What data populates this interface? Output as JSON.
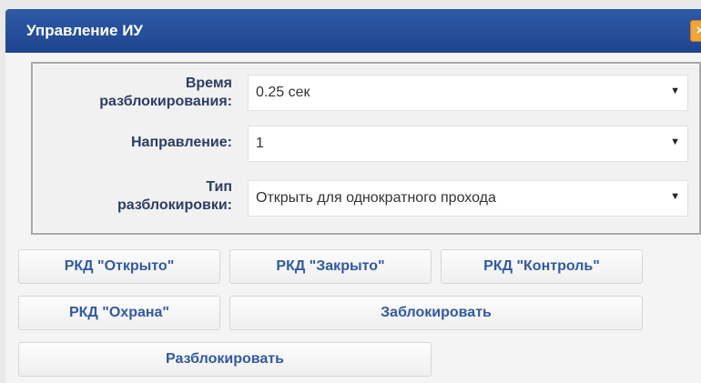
{
  "dialog": {
    "title": "Управление ИУ",
    "close_label": "×"
  },
  "form": {
    "unlock_time": {
      "label_line1": "Время",
      "label_line2": "разблокирования:",
      "value": "0.25 сек"
    },
    "direction": {
      "label": "Направление:",
      "value": "1"
    },
    "unlock_type": {
      "label_line1": "Тип",
      "label_line2": "разблокировки:",
      "value": "Открыть для однократного прохода"
    },
    "dropdown_arrow": "▼"
  },
  "buttons": {
    "open": "РКД \"Открыто\"",
    "closed": "РКД \"Закрыто\"",
    "control": "РКД \"Контроль\"",
    "guard": "РКД \"Охрана\"",
    "lock": "Заблокировать",
    "unlock": "Разблокировать"
  }
}
